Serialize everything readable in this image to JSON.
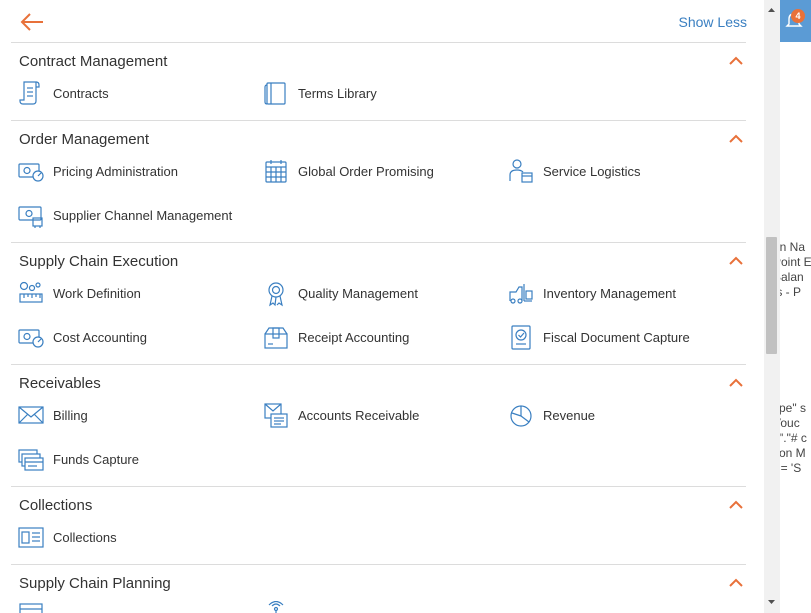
{
  "header": {
    "show_less_label": "Show Less"
  },
  "background": {
    "notification_count": "4",
    "fragments": [
      "on Na",
      "Point E",
      "Balan",
      "ts - P",
      "ype\" s",
      "Vouc",
      "s\".\"# c",
      "tion M",
      "\" = 'S"
    ]
  },
  "colors": {
    "accent_orange": "#e8713a",
    "icon_blue": "#3a7fc1",
    "link_blue": "#3a7fc1"
  },
  "sections": [
    {
      "title": "Contract Management",
      "items": [
        {
          "label": "Contracts",
          "icon": "contract-document-icon"
        },
        {
          "label": "Terms Library",
          "icon": "book-icon"
        }
      ]
    },
    {
      "title": "Order Management",
      "items": [
        {
          "label": "Pricing Administration",
          "icon": "money-gauge-icon"
        },
        {
          "label": "Global Order Promising",
          "icon": "calendar-grid-icon"
        },
        {
          "label": "Service Logistics",
          "icon": "person-box-icon"
        },
        {
          "label": "Supplier Channel Management",
          "icon": "money-gear-icon"
        }
      ]
    },
    {
      "title": "Supply Chain Execution",
      "items": [
        {
          "label": "Work Definition",
          "icon": "gears-ruler-icon"
        },
        {
          "label": "Quality Management",
          "icon": "award-ribbon-icon"
        },
        {
          "label": "Inventory Management",
          "icon": "forklift-icon"
        },
        {
          "label": "Cost Accounting",
          "icon": "money-gauge-icon"
        },
        {
          "label": "Receipt Accounting",
          "icon": "package-icon"
        },
        {
          "label": "Fiscal Document Capture",
          "icon": "document-check-icon"
        }
      ]
    },
    {
      "title": "Receivables",
      "items": [
        {
          "label": "Billing",
          "icon": "envelope-icon"
        },
        {
          "label": "Accounts Receivable",
          "icon": "invoice-envelope-icon"
        },
        {
          "label": "Revenue",
          "icon": "pie-chart-icon"
        },
        {
          "label": "Funds Capture",
          "icon": "cards-stack-icon"
        }
      ]
    },
    {
      "title": "Collections",
      "items": [
        {
          "label": "Collections",
          "icon": "collections-board-icon"
        }
      ]
    },
    {
      "title": "Supply Chain Planning",
      "items": [
        {
          "label": "",
          "icon": "planning-icon"
        },
        {
          "label": "",
          "icon": "wireless-icon"
        }
      ]
    }
  ]
}
